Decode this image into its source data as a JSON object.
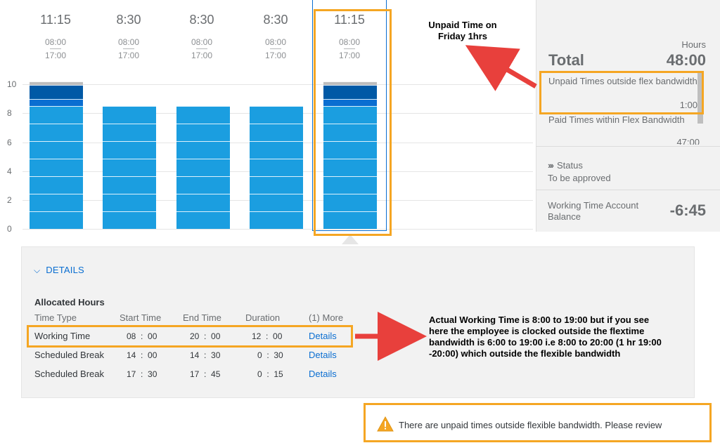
{
  "days": [
    {
      "total": "11:15",
      "start": "08:00",
      "end": "17:00"
    },
    {
      "total": "8:30",
      "start": "08:00",
      "end": "17:00"
    },
    {
      "total": "8:30",
      "start": "08:00",
      "end": "17:00"
    },
    {
      "total": "8:30",
      "start": "08:00",
      "end": "17:00"
    },
    {
      "total": "11:15",
      "start": "08:00",
      "end": "17:00"
    }
  ],
  "chart_data": {
    "type": "bar",
    "y_ticks": [
      "0",
      "2",
      "4",
      "6",
      "8",
      "10"
    ],
    "ylim": [
      0,
      10.5
    ],
    "series_values": [
      10.2,
      8.5,
      8.5,
      8.5,
      10.2
    ],
    "colors": {
      "main": "#1b9ee0",
      "dark": "#0a6ed1",
      "darker": "#0059a6",
      "gray": "#bdbdbd"
    }
  },
  "panel": {
    "hours_label": "Hours",
    "total_label": "Total",
    "total_value": "48:00",
    "unpaid_label": "Unpaid Times outside flex bandwidth",
    "unpaid_value": "1:00",
    "paid_label": "Paid Times within Flex Bandwidth",
    "paid_value": "47:00",
    "status_label": "Status",
    "status_value": "To be approved",
    "wtab_label": "Working Time Account Balance",
    "wtab_value": "-6:45"
  },
  "details": {
    "toggle_label": "DETAILS",
    "section_title": "Allocated Hours",
    "headers": [
      "Time Type",
      "Start Time",
      "End Time",
      "Duration",
      "(1) More"
    ],
    "rows": [
      {
        "type": "Working Time",
        "start_h": "08",
        "start_m": "00",
        "end_h": "20",
        "end_m": "00",
        "dur_h": "12",
        "dur_m": "00",
        "link": "Details"
      },
      {
        "type": "Scheduled Break",
        "start_h": "14",
        "start_m": "00",
        "end_h": "14",
        "end_m": "30",
        "dur_h": "0",
        "dur_m": "30",
        "link": "Details"
      },
      {
        "type": "Scheduled Break",
        "start_h": "17",
        "start_m": "30",
        "end_h": "17",
        "end_m": "45",
        "dur_h": "0",
        "dur_m": "15",
        "link": "Details"
      }
    ]
  },
  "annotations": {
    "friday_note": "Unpaid Time on Friday 1hrs",
    "working_note": "Actual Working Time is 8:00 to 19:00 but if you see here the employee is clocked outside the flextime bandwidth is 6:00 to 19:00 i.e 8:00 to 20:00 (1 hr 19:00 -20:00) which outside the flexible bandwidth"
  },
  "warning": {
    "text": "There are unpaid times outside flexible bandwidth. Please review",
    "icon": "warning-icon"
  }
}
